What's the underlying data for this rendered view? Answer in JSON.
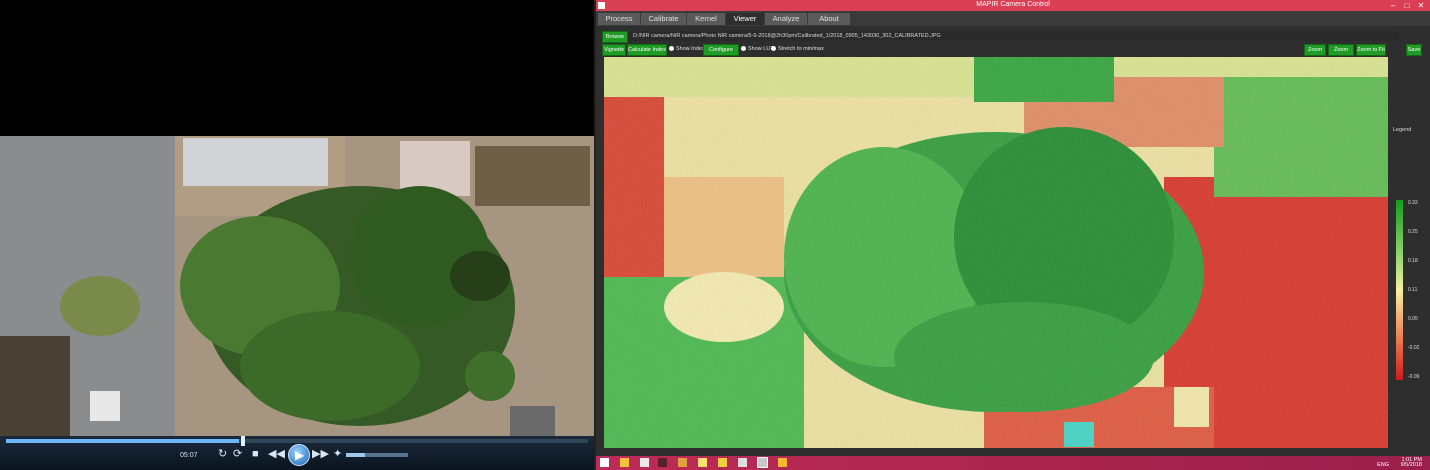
{
  "player": {
    "time": "05:07",
    "controls": [
      "↻",
      "⟳",
      "■",
      "◀◀",
      "▶",
      "▶▶",
      "✦"
    ],
    "progress": 0.4,
    "volume": 0.3
  },
  "app": {
    "window_title": "MAPIR Camera Control",
    "tabs": [
      "Process",
      "Calibrate",
      "Kernel",
      "Viewer",
      "Analyze",
      "About"
    ],
    "active_tab": "Viewer",
    "browse_label": "Browse",
    "file_path": "D:/NIR camera/NIR camera/Photo NIR camera/5-9-2018@2h30pm/Calibrated_1/2018_0905_143030_302_CALIBRATED.JPG",
    "toolbar": {
      "vignette": "Vignette",
      "calculate_index": "Calculate Index",
      "show_index": "Show Index",
      "configure_lut": "Configure LUT",
      "show_lut": "Show LUT",
      "stretch": "Stretch to min/max",
      "zoom_in": "Zoom In",
      "zoom_out": "Zoom Out",
      "zoom_fit": "Zoom to Fit",
      "save": "Save"
    },
    "legend": {
      "label": "Legend",
      "ticks": [
        "0.32",
        "0.25",
        "0.18",
        "0.11",
        "0.05",
        "-0.02",
        "-0.09"
      ],
      "colors": [
        "#149b20",
        "#8fd36b",
        "#f6f0a0",
        "#f19a63",
        "#d01a1a"
      ]
    }
  },
  "taskbar": {
    "lang": "ENG",
    "time": "1:01 PM",
    "date": "9/5/2018",
    "accent": "#bd2b56"
  }
}
